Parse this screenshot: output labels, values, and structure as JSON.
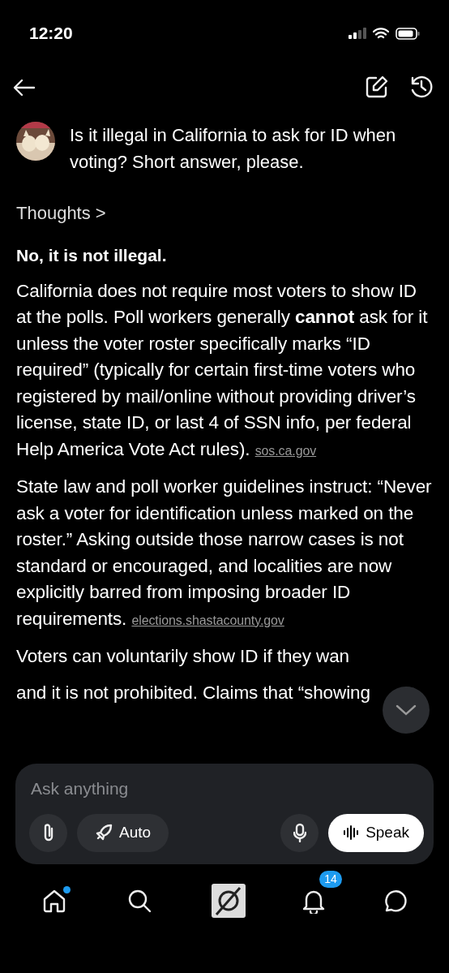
{
  "status_bar": {
    "time": "12:20"
  },
  "question": {
    "text": "Is it illegal in California to ask for ID when voting? Short answer, please."
  },
  "thoughts": {
    "label": "Thoughts",
    "chevron": ">"
  },
  "answer": {
    "heading": "No, it is not illegal.",
    "paragraphs": [
      {
        "text": "California does not require most voters to show ID at the polls. Poll workers generally **cannot** ask for it unless the voter roster specifically marks “ID required” (typically for certain first-time voters who registered by mail/online without providing driver’s license, state ID, or last 4 of SSN info, per federal Help America Vote Act rules).",
        "link": "sos.ca.gov"
      },
      {
        "text": "State law and poll worker guidelines instruct: “Never ask a voter for identification unless marked on the roster.” Asking outside those narrow cases is not standard or encouraged, and localities are now explicitly barred from imposing broader ID requirements.",
        "link": "elections.shastacounty.gov"
      },
      {
        "text": "Voters can voluntarily show ID if they wan"
      },
      {
        "text": "and it is not prohibited. Claims that “showing"
      }
    ]
  },
  "composer": {
    "placeholder": "Ask anything",
    "mode": "Auto",
    "speak": "Speak"
  },
  "tab_bar": {
    "home_unread": true,
    "notifications": "14"
  }
}
